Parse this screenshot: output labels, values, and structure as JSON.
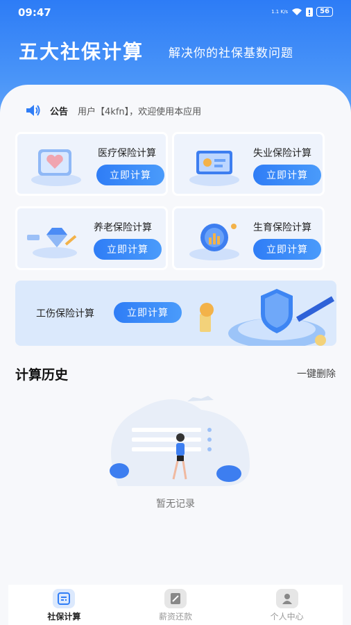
{
  "status_bar": {
    "time": "09:47",
    "network": "1.1\nK/s",
    "battery": "56"
  },
  "header": {
    "title": "五大社保计算",
    "subtitle": "解决你的社保基数问题"
  },
  "notice": {
    "label": "公告",
    "text": "用户【4kfn】，欢迎使用本应用"
  },
  "cards": [
    {
      "title": "医疗保险计算",
      "button": "立即计算"
    },
    {
      "title": "失业保险计算",
      "button": "立即计算"
    },
    {
      "title": "养老保险计算",
      "button": "立即计算"
    },
    {
      "title": "生育保险计算",
      "button": "立即计算"
    },
    {
      "title": "工伤保险计算",
      "button": "立即计算"
    }
  ],
  "history": {
    "title": "计算历史",
    "delete_all": "一键删除",
    "empty": "暂无记录"
  },
  "nav": [
    {
      "label": "社保计算",
      "icon": "calculator-icon",
      "active": true
    },
    {
      "label": "薪资还款",
      "icon": "notebook-icon",
      "active": false
    },
    {
      "label": "个人中心",
      "icon": "person-icon",
      "active": false
    }
  ],
  "colors": {
    "primary": "#2f7df6",
    "card_bg": "#eef3fc"
  }
}
